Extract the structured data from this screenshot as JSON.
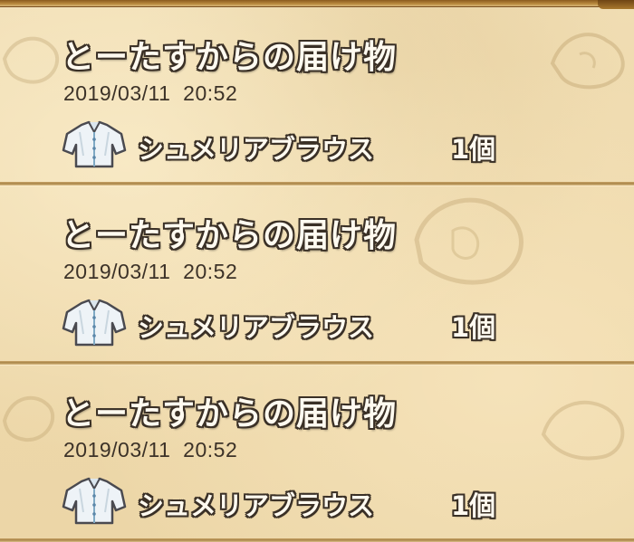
{
  "theme": {
    "parchment": "#efdcb1",
    "text_outline": "#3a3026",
    "text_fill": "#fffaf0",
    "date_color": "#3c3228",
    "divider": "#a98447"
  },
  "entries": [
    {
      "title": "とーたすからの届け物",
      "date": "2019/03/11  20:52",
      "item": {
        "icon": "blouse-icon",
        "name": "シュメリアブラウス",
        "quantity": "1個"
      }
    },
    {
      "title": "とーたすからの届け物",
      "date": "2019/03/11  20:52",
      "item": {
        "icon": "blouse-icon",
        "name": "シュメリアブラウス",
        "quantity": "1個"
      }
    },
    {
      "title": "とーたすからの届け物",
      "date": "2019/03/11  20:52",
      "item": {
        "icon": "blouse-icon",
        "name": "シュメリアブラウス",
        "quantity": "1個"
      }
    }
  ]
}
